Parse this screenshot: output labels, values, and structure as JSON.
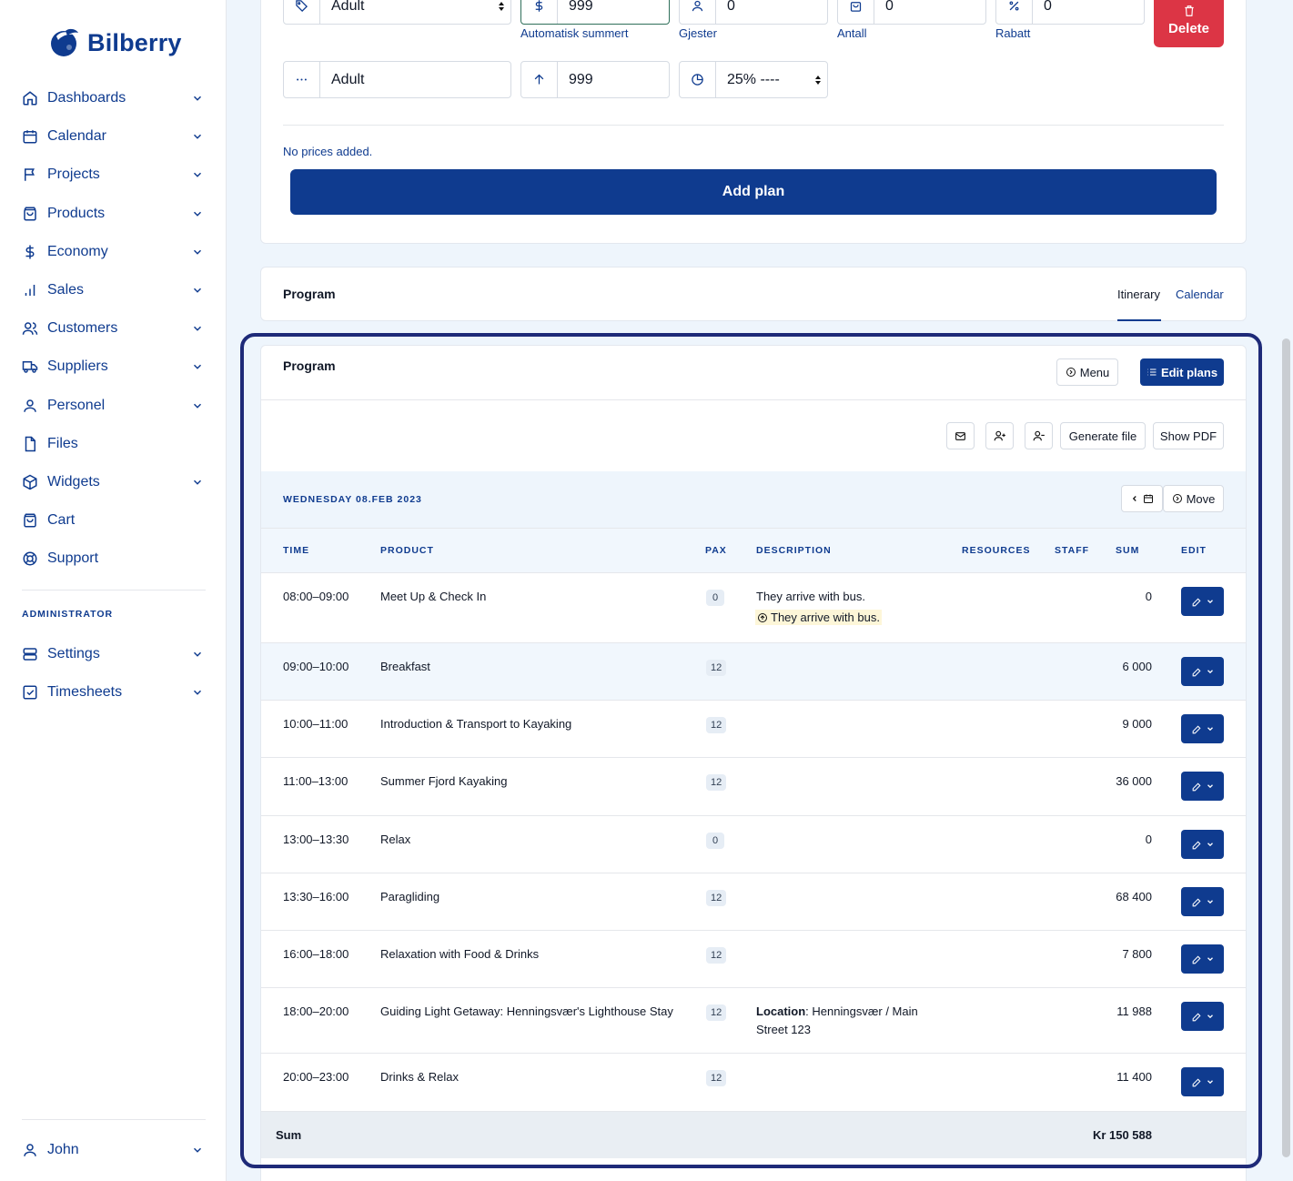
{
  "brand": {
    "name": "Bilberry",
    "accent": "#0f3b8f",
    "danger": "#dc3545"
  },
  "sidebar": {
    "items": [
      {
        "label": "Dashboards",
        "icon": "home-icon"
      },
      {
        "label": "Calendar",
        "icon": "calendar-icon"
      },
      {
        "label": "Projects",
        "icon": "flag-icon"
      },
      {
        "label": "Products",
        "icon": "bag-icon"
      },
      {
        "label": "Economy",
        "icon": "dollar-icon"
      },
      {
        "label": "Sales",
        "icon": "bar-chart-icon"
      },
      {
        "label": "Customers",
        "icon": "users-icon"
      },
      {
        "label": "Suppliers",
        "icon": "truck-icon"
      },
      {
        "label": "Personel",
        "icon": "user-icon"
      },
      {
        "label": "Files",
        "icon": "file-icon"
      },
      {
        "label": "Widgets",
        "icon": "cube-icon"
      },
      {
        "label": "Cart",
        "icon": "cart-icon"
      },
      {
        "label": "Support",
        "icon": "lifebuoy-icon"
      }
    ],
    "admin_label": "ADMINISTRATOR",
    "admin_items": [
      {
        "label": "Settings",
        "icon": "server-icon"
      },
      {
        "label": "Timesheets",
        "icon": "checkbox-icon"
      }
    ],
    "user": "John"
  },
  "price_form": {
    "row1": {
      "category": "Adult",
      "price": "999",
      "price_sub": "Automatisk summert",
      "guests": "0",
      "guests_sub": "Gjester",
      "quantity": "0",
      "quantity_sub": "Antall",
      "discount": "0",
      "discount_sub": "Rabatt",
      "delete_label": "Delete"
    },
    "row2": {
      "category": "Adult",
      "price": "999",
      "vat": "25% ----"
    },
    "no_prices": "No prices added.",
    "add_plan": "Add plan"
  },
  "program_header": {
    "title": "Program",
    "tabs": [
      "Itinerary",
      "Calendar"
    ],
    "active_tab": "Itinerary"
  },
  "program": {
    "title": "Program",
    "menu_label": "Menu",
    "edit_plans_label": "Edit plans",
    "generate_file": "Generate file",
    "show_pdf": "Show PDF",
    "date": "WEDNESDAY 08.FEB 2023",
    "move_label": "Move",
    "columns": {
      "time": "TIME",
      "product": "PRODUCT",
      "pax": "PAX",
      "description": "DESCRIPTION",
      "resources": "RESOURCES",
      "staff": "STAFF",
      "sum": "SUM",
      "edit": "EDIT"
    },
    "rows": [
      {
        "time": "08:00–09:00",
        "product": "Meet Up & Check In",
        "pax": "0",
        "description": "They arrive with bus.",
        "note": "They arrive with bus.",
        "sum": "0"
      },
      {
        "time": "09:00–10:00",
        "product": "Breakfast",
        "pax": "12",
        "sum": "6 000"
      },
      {
        "time": "10:00–11:00",
        "product": "Introduction & Transport to Kayaking",
        "pax": "12",
        "sum": "9 000"
      },
      {
        "time": "11:00–13:00",
        "product": "Summer Fjord Kayaking",
        "pax": "12",
        "sum": "36 000"
      },
      {
        "time": "13:00–13:30",
        "product": "Relax",
        "pax": "0",
        "sum": "0"
      },
      {
        "time": "13:30–16:00",
        "product": "Paragliding",
        "pax": "12",
        "sum": "68 400"
      },
      {
        "time": "16:00–18:00",
        "product": "Relaxation with Food & Drinks",
        "pax": "12",
        "sum": "7 800"
      },
      {
        "time": "18:00–20:00",
        "product": "Guiding Light Getaway: Henningsvær's Lighthouse Stay",
        "pax": "12",
        "location_label": "Location",
        "location_value": ": Henningsvær / Main",
        "location_value2": "Street 123",
        "sum": "11 988"
      },
      {
        "time": "20:00–23:00",
        "product": "Drinks & Relax",
        "pax": "12",
        "sum": "11 400"
      }
    ],
    "sum_label": "Sum",
    "sum_total": "Kr 150 588"
  }
}
